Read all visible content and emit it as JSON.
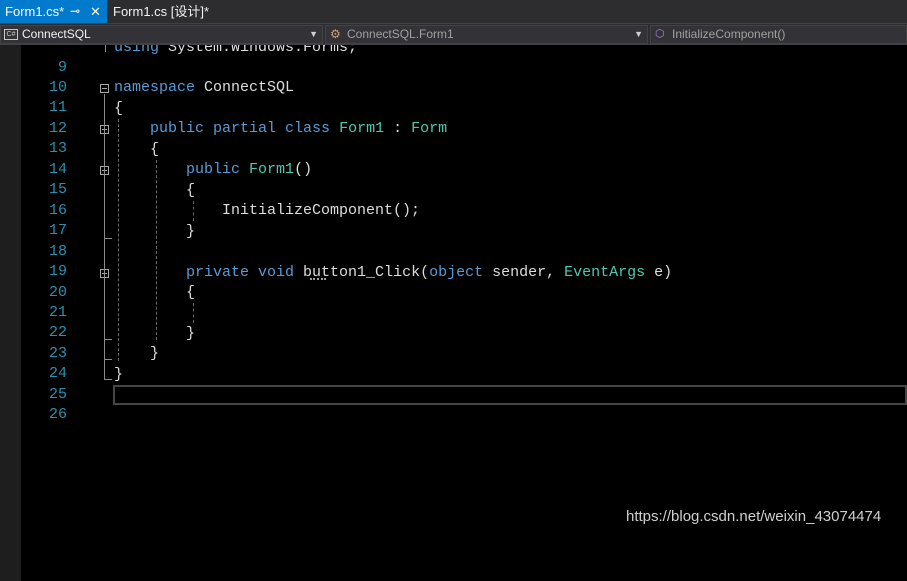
{
  "tabs": [
    {
      "label": "Form1.cs*",
      "pin": "⊸",
      "close": "✕"
    },
    {
      "label": "Form1.cs [设计]*"
    }
  ],
  "nav": {
    "project": "ConnectSQL",
    "project_icon": "C#",
    "class": "ConnectSQL.Form1",
    "member": "InitializeComponent()",
    "arrow": "▼"
  },
  "icons": {
    "project": "csharp-project-icon",
    "class": "class-icon",
    "member": "method-icon"
  },
  "lines": [
    {
      "n": "9",
      "t": "using System.Windows.Forms;"
    },
    {
      "n": "10",
      "t": ""
    },
    {
      "n": "11",
      "t": "namespace ConnectSQL"
    },
    {
      "n": "12",
      "t": "{"
    },
    {
      "n": "13",
      "t": "    public partial class Form1 : Form"
    },
    {
      "n": "14",
      "t": "    {"
    },
    {
      "n": "15",
      "t": "        public Form1()"
    },
    {
      "n": "16",
      "t": "        {"
    },
    {
      "n": "17",
      "t": "            InitializeComponent();"
    },
    {
      "n": "18",
      "t": "        }"
    },
    {
      "n": "19",
      "t": ""
    },
    {
      "n": "20",
      "t": "        private void button1_Click(object sender, EventArgs e)"
    },
    {
      "n": "21",
      "t": "        {"
    },
    {
      "n": "22",
      "t": ""
    },
    {
      "n": "23",
      "t": "        }"
    },
    {
      "n": "24",
      "t": "    }"
    },
    {
      "n": "25",
      "t": "}"
    },
    {
      "n": "26",
      "t": ""
    }
  ],
  "watermark": "https://blog.csdn.net/weixin_43074474",
  "colors": {
    "accent": "#007acc",
    "keyword": "#569cd6",
    "type": "#4ec9b0",
    "line_number": "#2b91af",
    "text": "#dcdcdc",
    "background": "#000000"
  }
}
